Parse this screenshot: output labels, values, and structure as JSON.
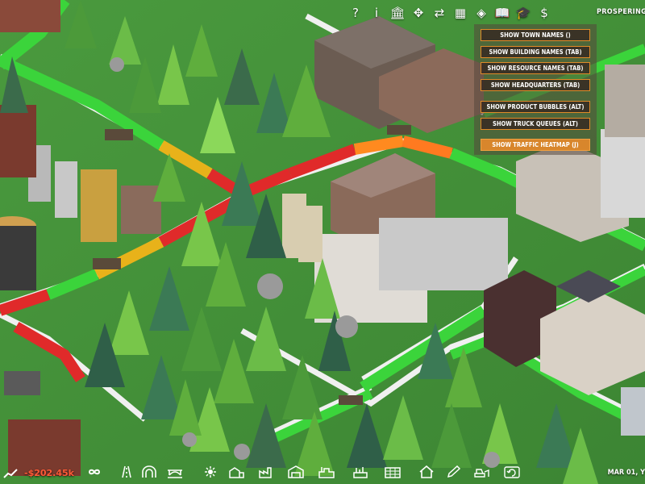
{
  "hud": {
    "status": "PROSPERING",
    "money": "-$202.45k",
    "date": "MAR 01, Y"
  },
  "top_toolbar": [
    {
      "icon": "help-icon",
      "glyph": "?"
    },
    {
      "icon": "info-icon",
      "glyph": "i"
    },
    {
      "icon": "bank-icon",
      "glyph": "🏛"
    },
    {
      "icon": "move-icon",
      "glyph": "✥"
    },
    {
      "icon": "swap-arrows-icon",
      "glyph": "⇄"
    },
    {
      "icon": "building-grid-icon",
      "glyph": "▦"
    },
    {
      "icon": "layers-icon",
      "glyph": "◈"
    },
    {
      "icon": "book-icon",
      "glyph": "📖"
    },
    {
      "icon": "research-icon",
      "glyph": "🎓"
    },
    {
      "icon": "finance-icon",
      "glyph": "$"
    }
  ],
  "overlay_menu": [
    {
      "label": "SHOW TOWN NAMES ()",
      "active": false
    },
    {
      "label": "SHOW BUILDING NAMES (TAB)",
      "active": false
    },
    {
      "label": "SHOW RESOURCE NAMES (TAB)",
      "active": false
    },
    {
      "label": "SHOW HEADQUARTERS (TAB)",
      "active": false
    },
    {
      "label": "SHOW PRODUCT BUBBLES (ALT)",
      "active": false
    },
    {
      "label": "SHOW TRUCK QUEUES (ALT)",
      "active": false
    },
    {
      "label": "SHOW TRAFFIC HEATMAP (J)",
      "active": true
    }
  ],
  "bottom_toolbar": [
    "infinity-icon",
    "road-icon",
    "tunnel-icon",
    "bridge-icon",
    "sun-icon",
    "farm-icon",
    "factory-icon",
    "warehouse-icon",
    "industry-icon",
    "plant-icon",
    "storage-icon",
    "house-icon",
    "pencil-icon",
    "bulldozer-icon",
    "undo-icon"
  ]
}
